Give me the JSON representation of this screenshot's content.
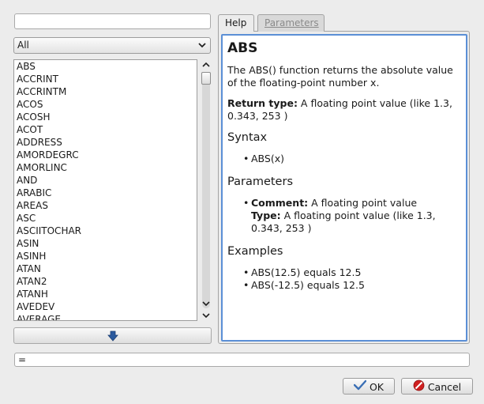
{
  "search": {
    "value": ""
  },
  "category": {
    "selected": "All"
  },
  "functions": [
    "ABS",
    "ACCRINT",
    "ACCRINTM",
    "ACOS",
    "ACOSH",
    "ACOT",
    "ADDRESS",
    "AMORDEGRC",
    "AMORLINC",
    "AND",
    "ARABIC",
    "AREAS",
    "ASC",
    "ASCIITOCHAR",
    "ASIN",
    "ASINH",
    "ATAN",
    "ATAN2",
    "ATANH",
    "AVEDEV",
    "AVERAGE"
  ],
  "tabs": {
    "help": "Help",
    "parameters": "Parameters"
  },
  "help": {
    "title": "ABS",
    "description": "The ABS() function returns the absolute value of the floating-point number x.",
    "return_label": "Return type:",
    "return_value": " A floating point value (like 1.3, 0.343, 253 )",
    "syntax_heading": "Syntax",
    "syntax": "ABS(x)",
    "parameters_heading": "Parameters",
    "param_comment_label": "Comment:",
    "param_comment": " A floating point value",
    "param_type_label": "Type:",
    "param_type": " A floating point value (like 1.3, 0.343, 253 )",
    "examples_heading": "Examples",
    "examples": [
      "ABS(12.5) equals 12.5",
      "ABS(-12.5) equals 12.5"
    ]
  },
  "formula": "=",
  "buttons": {
    "ok": "OK",
    "cancel": "Cancel"
  },
  "colors": {
    "focus_border": "#5b8fd6",
    "insert_arrow": "#2a5a9e",
    "cancel_icon": "#d02020",
    "ok_check": "#3a6fb5"
  }
}
